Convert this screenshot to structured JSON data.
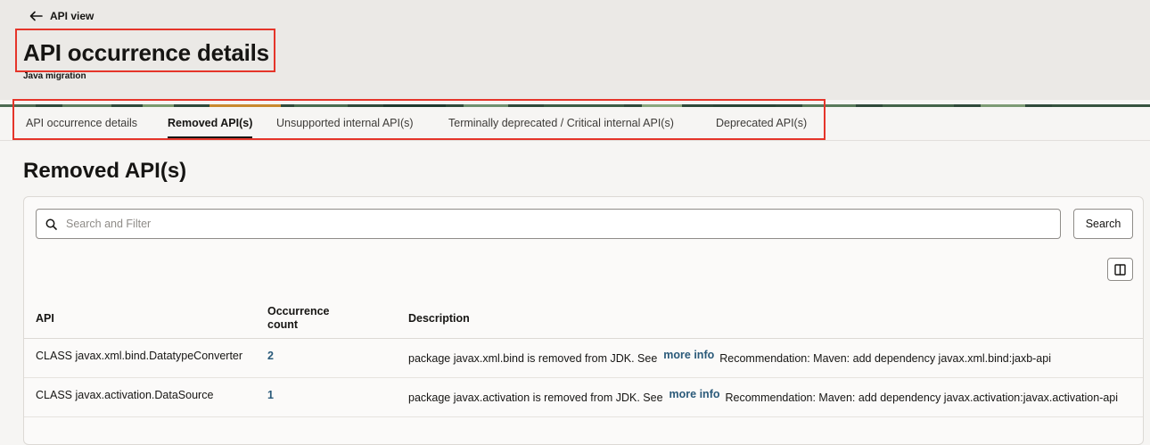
{
  "header": {
    "back_label": "API view",
    "title": "API occurrence details",
    "subtitle": "Java migration"
  },
  "tabs": [
    {
      "label": "API occurrence details",
      "active": false
    },
    {
      "label": "Removed API(s)",
      "active": true
    },
    {
      "label": "Unsupported internal API(s)",
      "active": false
    },
    {
      "label": "Terminally deprecated / Critical internal API(s)",
      "active": false
    },
    {
      "label": "Deprecated API(s)",
      "active": false
    }
  ],
  "section": {
    "title": "Removed API(s)"
  },
  "search": {
    "placeholder": "Search and Filter",
    "value": "",
    "button_label": "Search"
  },
  "table": {
    "columns": [
      "API",
      "Occurrence count",
      "Description"
    ],
    "rows": [
      {
        "api": "CLASS javax.xml.bind.DatatypeConverter",
        "count": "2",
        "description_before": "package javax.xml.bind is removed from JDK.  See",
        "link_label": "more info",
        "description_after": "Recommendation: Maven: add dependency javax.xml.bind:jaxb-api"
      },
      {
        "api": "CLASS javax.activation.DataSource",
        "count": "1",
        "description_before": "package javax.activation is removed from JDK.  See",
        "link_label": "more info",
        "description_after": "Recommendation: Maven: add dependency javax.activation:javax.activation-api"
      }
    ]
  },
  "icons": {
    "back": "arrow-left-icon",
    "search": "search-icon",
    "columns": "columns-icon"
  },
  "colors": {
    "highlight": "#e5352a",
    "link": "#2a5a7a",
    "header_bg": "#ebe9e6",
    "page_bg": "#f6f5f3"
  }
}
